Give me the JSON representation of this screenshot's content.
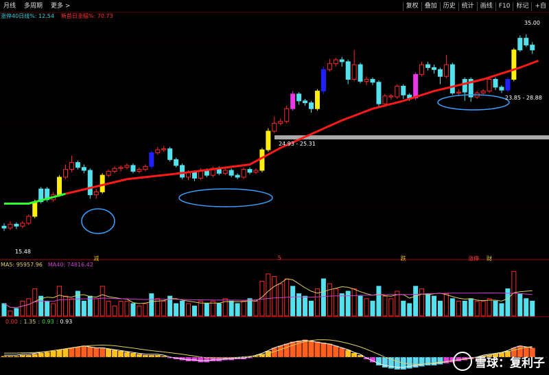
{
  "toolbar": {
    "left": [
      "月线",
      "多周期",
      "更多 >"
    ],
    "right": [
      "复权",
      "叠加",
      "历史",
      "统计",
      "画线",
      "F10",
      "标记",
      "+自"
    ]
  },
  "info": {
    "ma_label": "涨停40日线%: 12.54",
    "ma_color": "#36d0d8",
    "extra_label": "新首日涨幅%: 70.73",
    "extra_color": "#ff3030"
  },
  "price_labels": {
    "low": "15.48",
    "mid": "24.93 - 25.31",
    "high": "35.00",
    "right": "23.85 - 28.88"
  },
  "event_tags": [
    {
      "text": "减",
      "color": "#e0c020",
      "index": 15
    },
    {
      "text": "5",
      "color": "#ff4040",
      "index": 45
    },
    {
      "text": "跌",
      "color": "#e0c020",
      "index": 65
    },
    {
      "text": "涨停",
      "color": "#ff4040",
      "index": 76
    },
    {
      "text": "财",
      "color": "#d0d040",
      "index": 79
    }
  ],
  "volume_info": {
    "ma5": "MA5: 95957.96",
    "ma40": "MA40: 74816.42",
    "ma5_color": "#e0d060",
    "ma40_color": "#d040d0"
  },
  "macd_info": {
    "v1": "0.00",
    "v2": "1.35",
    "v3": "0.93",
    "v4": "0.93",
    "v1_color": "#ff3030",
    "v2_color": "#e0d060",
    "v3_color": "#30e030",
    "v4_color": "#ffffff"
  },
  "watermark": "雪球：复利子",
  "colors": {
    "up": "#ff2828",
    "down": "#54e0ec",
    "ma": "#ff1a1a",
    "yellow": "#ffee10",
    "magenta": "#e838e8",
    "blue": "#2020ff",
    "green": "#30ff30",
    "white": "#ffffff"
  },
  "chart_data": {
    "type": "candlestick",
    "price_range": [
      13,
      37
    ],
    "candles": [
      {
        "o": 16.0,
        "c": 15.8,
        "h": 16.3,
        "l": 15.5,
        "t": "down"
      },
      {
        "o": 15.8,
        "c": 16.2,
        "h": 16.5,
        "l": 15.6,
        "t": "up"
      },
      {
        "o": 16.2,
        "c": 16.0,
        "h": 16.4,
        "l": 15.7,
        "t": "down"
      },
      {
        "o": 16.0,
        "c": 16.3,
        "h": 16.5,
        "l": 15.8,
        "t": "up"
      },
      {
        "o": 16.3,
        "c": 17.0,
        "h": 17.2,
        "l": 16.1,
        "t": "up"
      },
      {
        "o": 17.0,
        "c": 18.5,
        "h": 18.7,
        "l": 16.8,
        "t": "yellow"
      },
      {
        "o": 18.5,
        "c": 19.8,
        "h": 20.0,
        "l": 18.3,
        "t": "down"
      },
      {
        "o": 19.8,
        "c": 18.7,
        "h": 20.0,
        "l": 18.5,
        "t": "down"
      },
      {
        "o": 18.7,
        "c": 19.2,
        "h": 19.5,
        "l": 18.5,
        "t": "up"
      },
      {
        "o": 19.2,
        "c": 21.0,
        "h": 21.2,
        "l": 19.0,
        "t": "yellow"
      },
      {
        "o": 21.0,
        "c": 21.8,
        "h": 22.3,
        "l": 20.8,
        "t": "up"
      },
      {
        "o": 21.8,
        "c": 22.5,
        "h": 23.2,
        "l": 21.5,
        "t": "up"
      },
      {
        "o": 22.5,
        "c": 22.0,
        "h": 22.7,
        "l": 21.8,
        "t": "down"
      },
      {
        "o": 22.0,
        "c": 21.7,
        "h": 22.3,
        "l": 21.4,
        "t": "down"
      },
      {
        "o": 21.7,
        "c": 19.2,
        "h": 21.9,
        "l": 18.8,
        "t": "down"
      },
      {
        "o": 19.2,
        "c": 19.5,
        "h": 19.8,
        "l": 18.8,
        "t": "up"
      },
      {
        "o": 19.5,
        "c": 21.2,
        "h": 21.4,
        "l": 19.3,
        "t": "yellow"
      },
      {
        "o": 21.2,
        "c": 21.6,
        "h": 21.8,
        "l": 21.0,
        "t": "up"
      },
      {
        "o": 21.6,
        "c": 21.9,
        "h": 22.1,
        "l": 21.4,
        "t": "up"
      },
      {
        "o": 21.9,
        "c": 22.0,
        "h": 22.2,
        "l": 21.6,
        "t": "up"
      },
      {
        "o": 22.0,
        "c": 22.2,
        "h": 22.4,
        "l": 21.8,
        "t": "up"
      },
      {
        "o": 22.2,
        "c": 21.6,
        "h": 22.4,
        "l": 21.4,
        "t": "down"
      },
      {
        "o": 21.6,
        "c": 21.8,
        "h": 22.0,
        "l": 21.4,
        "t": "up"
      },
      {
        "o": 21.8,
        "c": 22.1,
        "h": 22.3,
        "l": 21.6,
        "t": "up"
      },
      {
        "o": 22.1,
        "c": 23.5,
        "h": 23.7,
        "l": 21.9,
        "t": "blue"
      },
      {
        "o": 23.5,
        "c": 23.8,
        "h": 24.1,
        "l": 23.3,
        "t": "up"
      },
      {
        "o": 23.8,
        "c": 23.9,
        "h": 24.2,
        "l": 23.6,
        "t": "up"
      },
      {
        "o": 23.9,
        "c": 22.8,
        "h": 24.1,
        "l": 22.6,
        "t": "down"
      },
      {
        "o": 22.8,
        "c": 22.2,
        "h": 23.0,
        "l": 22.0,
        "t": "down"
      },
      {
        "o": 22.2,
        "c": 21.0,
        "h": 22.4,
        "l": 20.8,
        "t": "down"
      },
      {
        "o": 21.0,
        "c": 21.5,
        "h": 21.7,
        "l": 20.7,
        "t": "up"
      },
      {
        "o": 21.5,
        "c": 20.9,
        "h": 21.7,
        "l": 20.6,
        "t": "down"
      },
      {
        "o": 20.9,
        "c": 21.7,
        "h": 21.9,
        "l": 20.7,
        "t": "up"
      },
      {
        "o": 21.7,
        "c": 21.2,
        "h": 21.9,
        "l": 21.0,
        "t": "down"
      },
      {
        "o": 21.2,
        "c": 21.9,
        "h": 22.1,
        "l": 21.0,
        "t": "up"
      },
      {
        "o": 21.9,
        "c": 21.4,
        "h": 22.1,
        "l": 21.2,
        "t": "down"
      },
      {
        "o": 21.4,
        "c": 21.7,
        "h": 21.9,
        "l": 21.2,
        "t": "up"
      },
      {
        "o": 21.7,
        "c": 21.2,
        "h": 21.9,
        "l": 21.0,
        "t": "down"
      },
      {
        "o": 21.2,
        "c": 21.0,
        "h": 21.4,
        "l": 20.8,
        "t": "down"
      },
      {
        "o": 21.0,
        "c": 21.8,
        "h": 22.0,
        "l": 20.8,
        "t": "up"
      },
      {
        "o": 21.8,
        "c": 21.5,
        "h": 22.0,
        "l": 21.3,
        "t": "down"
      },
      {
        "o": 21.5,
        "c": 21.7,
        "h": 21.9,
        "l": 21.3,
        "t": "up"
      },
      {
        "o": 21.7,
        "c": 23.8,
        "h": 24.0,
        "l": 21.5,
        "t": "yellow"
      },
      {
        "o": 23.8,
        "c": 25.7,
        "h": 26.0,
        "l": 23.6,
        "t": "yellow"
      },
      {
        "o": 25.7,
        "c": 26.5,
        "h": 27.2,
        "l": 25.5,
        "t": "up"
      },
      {
        "o": 26.5,
        "c": 26.7,
        "h": 27.0,
        "l": 26.3,
        "t": "up"
      },
      {
        "o": 26.7,
        "c": 28.0,
        "h": 28.3,
        "l": 26.5,
        "t": "up"
      },
      {
        "o": 28.0,
        "c": 29.5,
        "h": 29.8,
        "l": 27.8,
        "t": "magenta"
      },
      {
        "o": 29.5,
        "c": 28.8,
        "h": 29.7,
        "l": 28.4,
        "t": "down"
      },
      {
        "o": 28.8,
        "c": 28.6,
        "h": 29.0,
        "l": 28.3,
        "t": "down"
      },
      {
        "o": 28.6,
        "c": 28.0,
        "h": 28.8,
        "l": 27.6,
        "t": "down"
      },
      {
        "o": 28.0,
        "c": 29.8,
        "h": 30.0,
        "l": 27.8,
        "t": "yellow"
      },
      {
        "o": 29.8,
        "c": 32.0,
        "h": 32.3,
        "l": 29.5,
        "t": "blue"
      },
      {
        "o": 32.0,
        "c": 32.6,
        "h": 33.1,
        "l": 31.8,
        "t": "up"
      },
      {
        "o": 32.6,
        "c": 33.0,
        "h": 33.2,
        "l": 32.3,
        "t": "up"
      },
      {
        "o": 33.0,
        "c": 32.8,
        "h": 33.3,
        "l": 32.3,
        "t": "down"
      },
      {
        "o": 32.8,
        "c": 31.0,
        "h": 33.0,
        "l": 30.5,
        "t": "down"
      },
      {
        "o": 31.0,
        "c": 32.5,
        "h": 34.0,
        "l": 30.8,
        "t": "up"
      },
      {
        "o": 32.5,
        "c": 30.8,
        "h": 32.7,
        "l": 30.6,
        "t": "down"
      },
      {
        "o": 30.8,
        "c": 31.0,
        "h": 31.3,
        "l": 30.4,
        "t": "up"
      },
      {
        "o": 31.0,
        "c": 30.7,
        "h": 31.2,
        "l": 30.4,
        "t": "down"
      },
      {
        "o": 30.7,
        "c": 28.5,
        "h": 30.9,
        "l": 28.2,
        "t": "down"
      },
      {
        "o": 28.5,
        "c": 29.3,
        "h": 29.5,
        "l": 28.2,
        "t": "up"
      },
      {
        "o": 29.3,
        "c": 29.2,
        "h": 29.5,
        "l": 28.9,
        "t": "up"
      },
      {
        "o": 29.2,
        "c": 30.3,
        "h": 30.5,
        "l": 29.0,
        "t": "up"
      },
      {
        "o": 30.3,
        "c": 29.4,
        "h": 30.5,
        "l": 29.0,
        "t": "down"
      },
      {
        "o": 29.4,
        "c": 29.1,
        "h": 29.6,
        "l": 28.8,
        "t": "down"
      },
      {
        "o": 29.1,
        "c": 31.5,
        "h": 31.7,
        "l": 28.9,
        "t": "magenta"
      },
      {
        "o": 31.5,
        "c": 32.5,
        "h": 32.8,
        "l": 31.3,
        "t": "up"
      },
      {
        "o": 32.5,
        "c": 32.2,
        "h": 32.8,
        "l": 31.9,
        "t": "down"
      },
      {
        "o": 32.2,
        "c": 32.0,
        "h": 32.5,
        "l": 31.6,
        "t": "down"
      },
      {
        "o": 32.0,
        "c": 31.3,
        "h": 32.2,
        "l": 30.5,
        "t": "down"
      },
      {
        "o": 31.3,
        "c": 32.5,
        "h": 33.5,
        "l": 31.1,
        "t": "up"
      },
      {
        "o": 32.5,
        "c": 29.6,
        "h": 32.7,
        "l": 29.4,
        "t": "down"
      },
      {
        "o": 29.6,
        "c": 29.7,
        "h": 30.0,
        "l": 29.3,
        "t": "up"
      },
      {
        "o": 29.7,
        "c": 31.0,
        "h": 31.2,
        "l": 28.8,
        "t": "down"
      },
      {
        "o": 31.0,
        "c": 29.2,
        "h": 31.2,
        "l": 28.7,
        "t": "down"
      },
      {
        "o": 29.2,
        "c": 29.6,
        "h": 29.8,
        "l": 29.0,
        "t": "up"
      },
      {
        "o": 29.6,
        "c": 29.8,
        "h": 30.0,
        "l": 29.4,
        "t": "up"
      },
      {
        "o": 29.8,
        "c": 31.0,
        "h": 31.2,
        "l": 29.6,
        "t": "up"
      },
      {
        "o": 31.0,
        "c": 30.2,
        "h": 31.2,
        "l": 29.9,
        "t": "down"
      },
      {
        "o": 30.2,
        "c": 29.9,
        "h": 30.4,
        "l": 29.6,
        "t": "down"
      },
      {
        "o": 29.9,
        "c": 31.0,
        "h": 31.2,
        "l": 29.7,
        "t": "blue"
      },
      {
        "o": 31.0,
        "c": 34.0,
        "h": 34.2,
        "l": 30.8,
        "t": "yellow"
      },
      {
        "o": 34.0,
        "c": 35.2,
        "h": 35.5,
        "l": 33.8,
        "t": "down"
      },
      {
        "o": 35.2,
        "c": 34.5,
        "h": 35.6,
        "l": 34.3,
        "t": "down"
      },
      {
        "o": 34.5,
        "c": 34.0,
        "h": 34.8,
        "l": 33.6,
        "t": "down"
      }
    ],
    "ma_line": [
      [
        0,
        18.3
      ],
      [
        4,
        18.3
      ],
      [
        10,
        19.3
      ],
      [
        20,
        20.8
      ],
      [
        30,
        21.5
      ],
      [
        40,
        22.3
      ],
      [
        45,
        24.0
      ],
      [
        55,
        26.8
      ],
      [
        60,
        28.0
      ],
      [
        65,
        28.8
      ],
      [
        70,
        29.8
      ],
      [
        78,
        31.0
      ],
      [
        84,
        32.2
      ],
      [
        87,
        32.9
      ]
    ],
    "volume": {
      "range": [
        0,
        180000
      ],
      "bars_scale": [
        0.25,
        0.1,
        0.15,
        0.3,
        0.35,
        0.55,
        0.4,
        0.3,
        0.25,
        0.6,
        0.4,
        0.35,
        0.5,
        0.3,
        0.4,
        0.35,
        0.6,
        0.3,
        0.2,
        0.3,
        0.3,
        0.25,
        0.2,
        0.25,
        0.45,
        0.35,
        0.3,
        0.4,
        0.25,
        0.3,
        0.25,
        0.2,
        0.3,
        0.25,
        0.3,
        0.25,
        0.35,
        0.3,
        0.25,
        0.3,
        0.35,
        0.3,
        0.7,
        0.85,
        0.8,
        0.65,
        0.75,
        0.6,
        0.45,
        0.4,
        0.3,
        0.55,
        0.75,
        0.65,
        0.55,
        0.45,
        0.5,
        0.55,
        0.4,
        0.35,
        0.3,
        0.6,
        0.4,
        0.35,
        0.5,
        0.3,
        0.25,
        0.6,
        0.55,
        0.45,
        0.4,
        0.3,
        0.45,
        0.35,
        0.3,
        0.3,
        0.35,
        0.3,
        0.3,
        0.35,
        0.3,
        0.25,
        0.55,
        0.9,
        0.45,
        0.35,
        0.3
      ]
    },
    "macd": {
      "hist_scale": [
        0.05,
        0.05,
        0.05,
        0.1,
        0.1,
        0.15,
        0.2,
        0.25,
        0.3,
        0.35,
        0.4,
        0.45,
        0.5,
        0.55,
        0.5,
        0.45,
        0.45,
        0.4,
        0.35,
        0.3,
        0.25,
        0.2,
        0.15,
        0.1,
        0.1,
        0.1,
        0.05,
        -0.05,
        -0.1,
        -0.15,
        -0.2,
        -0.2,
        -0.25,
        -0.25,
        -0.2,
        -0.2,
        -0.15,
        -0.15,
        -0.1,
        -0.1,
        -0.05,
        0.05,
        0.15,
        0.3,
        0.45,
        0.55,
        0.65,
        0.75,
        0.8,
        0.85,
        0.8,
        0.75,
        0.7,
        0.65,
        0.55,
        0.45,
        0.35,
        0.2,
        0.1,
        -0.1,
        -0.25,
        -0.4,
        -0.5,
        -0.55,
        -0.6,
        -0.6,
        -0.55,
        -0.5,
        -0.45,
        -0.4,
        -0.4,
        -0.35,
        -0.3,
        -0.25,
        -0.2,
        -0.15,
        -0.1,
        -0.05,
        0.05,
        0.1,
        0.15,
        0.2,
        0.3,
        0.45,
        0.55,
        0.5,
        0.45
      ]
    }
  }
}
